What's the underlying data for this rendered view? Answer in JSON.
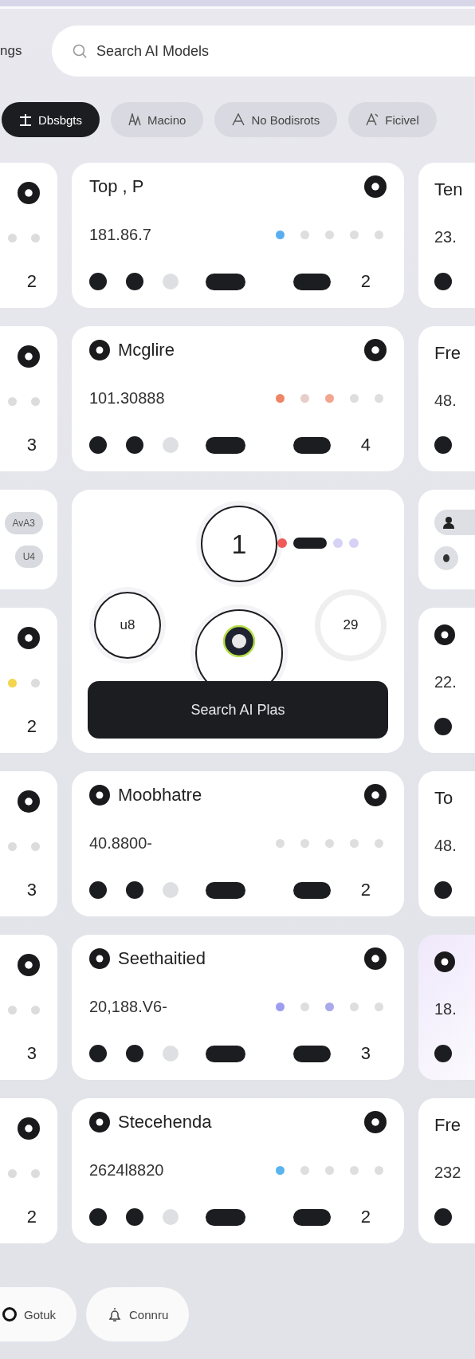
{
  "nav_label": "ngs",
  "search": {
    "placeholder": "Search AI Models"
  },
  "filters": [
    {
      "label": "Dbsbgts",
      "selected": true
    },
    {
      "label": "Macino",
      "selected": false
    },
    {
      "label": "No Bodisrots",
      "selected": false
    },
    {
      "label": "Ficivel",
      "selected": false
    }
  ],
  "left_column": [
    {
      "kind": "edge_metric",
      "dots": [
        {
          "color": "#dcdcdc"
        },
        {
          "color": "#dcdcdc"
        }
      ],
      "count": "2"
    },
    {
      "kind": "edge_metric",
      "dots": [
        {
          "color": "#dcdcdc"
        },
        {
          "color": "#dcdcdc"
        }
      ],
      "count": "3"
    },
    {
      "kind": "chips",
      "chips": [
        "AvA3",
        "U4"
      ]
    },
    {
      "kind": "edge_metric",
      "dots": [
        {
          "color": "#f3d54e"
        },
        {
          "color": "#dcdcdc"
        }
      ],
      "count": "2"
    },
    {
      "kind": "edge_metric",
      "dots": [
        {
          "color": "#dcdcdc"
        },
        {
          "color": "#dcdcdc"
        }
      ],
      "count": "3"
    },
    {
      "kind": "edge_metric",
      "dots": [
        {
          "color": "#dcdcdc"
        },
        {
          "color": "#dcdcdc"
        }
      ],
      "count": "3"
    },
    {
      "kind": "edge_metric",
      "dots": [
        {
          "color": "#dcdcdc"
        },
        {
          "color": "#dcdcdc"
        }
      ],
      "count": "2"
    }
  ],
  "center_column": [
    {
      "kind": "metric",
      "title": "Top , P",
      "title_icon": false,
      "value": "181.86.7",
      "dots": [
        {
          "color": "#5aaef0"
        },
        {
          "color": "#dedede"
        },
        {
          "color": "#dedede"
        },
        {
          "color": "#dedede"
        },
        {
          "color": "#dedede"
        }
      ],
      "count": "2"
    },
    {
      "kind": "metric",
      "title": "Mcglire",
      "title_icon": true,
      "value": "101.30888",
      "dots": [
        {
          "color": "#ee8565"
        },
        {
          "color": "#e6cfca"
        },
        {
          "color": "#f2a58f"
        },
        {
          "color": "#dedede"
        },
        {
          "color": "#dedede"
        }
      ],
      "count": "4"
    },
    {
      "kind": "feature",
      "main_number": "1",
      "left_number": "u8",
      "right_number": "29",
      "legend": [
        {
          "kind": "dot",
          "color": "#ef5b5b"
        },
        {
          "kind": "pill",
          "color": "#1c1d21"
        },
        {
          "kind": "dot",
          "color": "#d6d2f6"
        },
        {
          "kind": "dot",
          "color": "#d6d2f6"
        }
      ],
      "button": "Search AI Plas"
    },
    {
      "kind": "metric",
      "title": "Moobhatre",
      "title_icon": true,
      "value": "40.8800-",
      "dots": [
        {
          "color": "#dedede"
        },
        {
          "color": "#dedede"
        },
        {
          "color": "#dedede"
        },
        {
          "color": "#dedede"
        },
        {
          "color": "#dedede"
        }
      ],
      "count": "2"
    },
    {
      "kind": "metric",
      "title": "Seethaitied",
      "title_icon": true,
      "value": "20,188.V6-",
      "dots": [
        {
          "color": "#9c9cf0"
        },
        {
          "color": "#dedede"
        },
        {
          "color": "#a9a9ea"
        },
        {
          "color": "#dedede"
        },
        {
          "color": "#dedede"
        }
      ],
      "count": "3"
    },
    {
      "kind": "metric",
      "title": "Stecehenda",
      "title_icon": true,
      "value": "2624l8820",
      "dots": [
        {
          "color": "#5ab4ee"
        },
        {
          "color": "#dedede"
        },
        {
          "color": "#dedede"
        },
        {
          "color": "#dedede"
        },
        {
          "color": "#dedede"
        }
      ],
      "count": "2"
    }
  ],
  "right_column": [
    {
      "kind": "edge_metric",
      "title": "Ten",
      "title_icon": false,
      "value": "23.",
      "tinted": false
    },
    {
      "kind": "edge_metric",
      "title": "Fre",
      "title_icon": false,
      "value": "48.",
      "tinted": false
    },
    {
      "kind": "icon_chips"
    },
    {
      "kind": "edge_metric",
      "title_icon": true,
      "value": "22.",
      "tinted": false
    },
    {
      "kind": "edge_metric",
      "title": "To",
      "title_icon": false,
      "value": "48.",
      "tinted": false
    },
    {
      "kind": "edge_metric",
      "title_icon": true,
      "value": "18.",
      "tinted": true
    },
    {
      "kind": "edge_metric",
      "title": "Fre",
      "title_icon": false,
      "value": "232",
      "tinted": false
    }
  ],
  "footer_buttons": [
    {
      "label": "Gotuk"
    },
    {
      "label": "Connru"
    }
  ]
}
